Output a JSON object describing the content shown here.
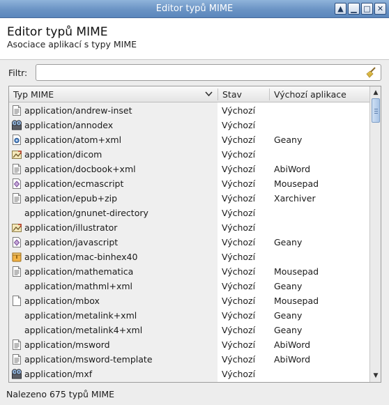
{
  "window": {
    "title": "Editor typů MIME",
    "buttons": {
      "restore_icon": "arrow-up-icon",
      "minimize_icon": "minimize-icon",
      "maximize_icon": "maximize-icon",
      "close_icon": "close-icon"
    }
  },
  "header": {
    "title": "Editor typů MIME",
    "subtitle": "Asociace aplikací s typy MIME"
  },
  "filter": {
    "label": "Filtr:",
    "value": "",
    "placeholder": "",
    "clear_icon": "broom-icon"
  },
  "table": {
    "columns": [
      "Typ MIME",
      "Stav",
      "Výchozí aplikace"
    ],
    "sort_icon": "chevron-down-icon",
    "rows": [
      {
        "type": "application/andrew-inset",
        "state": "Výchozí",
        "app": "",
        "icon": "text-file-icon"
      },
      {
        "type": "application/annodex",
        "state": "Výchozí",
        "app": "",
        "icon": "media-reel-icon"
      },
      {
        "type": "application/atom+xml",
        "state": "Výchozí",
        "app": "Geany",
        "icon": "feed-file-icon"
      },
      {
        "type": "application/dicom",
        "state": "Výchozí",
        "app": "",
        "icon": "image-file-icon"
      },
      {
        "type": "application/docbook+xml",
        "state": "Výchozí",
        "app": "AbiWord",
        "icon": "text-file-icon"
      },
      {
        "type": "application/ecmascript",
        "state": "Výchozí",
        "app": "Mousepad",
        "icon": "script-file-icon"
      },
      {
        "type": "application/epub+zip",
        "state": "Výchozí",
        "app": "Xarchiver",
        "icon": "text-file-icon"
      },
      {
        "type": "application/gnunet-directory",
        "state": "Výchozí",
        "app": "",
        "icon": ""
      },
      {
        "type": "application/illustrator",
        "state": "Výchozí",
        "app": "",
        "icon": "image-file-icon"
      },
      {
        "type": "application/javascript",
        "state": "Výchozí",
        "app": "Geany",
        "icon": "script-file-icon"
      },
      {
        "type": "application/mac-binhex40",
        "state": "Výchozí",
        "app": "",
        "icon": "archive-file-icon"
      },
      {
        "type": "application/mathematica",
        "state": "Výchozí",
        "app": "Mousepad",
        "icon": "text-file-icon"
      },
      {
        "type": "application/mathml+xml",
        "state": "Výchozí",
        "app": "Geany",
        "icon": ""
      },
      {
        "type": "application/mbox",
        "state": "Výchozí",
        "app": "Mousepad",
        "icon": "blank-file-icon"
      },
      {
        "type": "application/metalink+xml",
        "state": "Výchozí",
        "app": "Geany",
        "icon": ""
      },
      {
        "type": "application/metalink4+xml",
        "state": "Výchozí",
        "app": "Geany",
        "icon": ""
      },
      {
        "type": "application/msword",
        "state": "Výchozí",
        "app": "AbiWord",
        "icon": "text-file-icon"
      },
      {
        "type": "application/msword-template",
        "state": "Výchozí",
        "app": "AbiWord",
        "icon": "text-file-icon"
      },
      {
        "type": "application/mxf",
        "state": "Výchozí",
        "app": "",
        "icon": "media-reel-icon"
      }
    ]
  },
  "status": {
    "text": "Nalezeno 675 typů MIME"
  }
}
